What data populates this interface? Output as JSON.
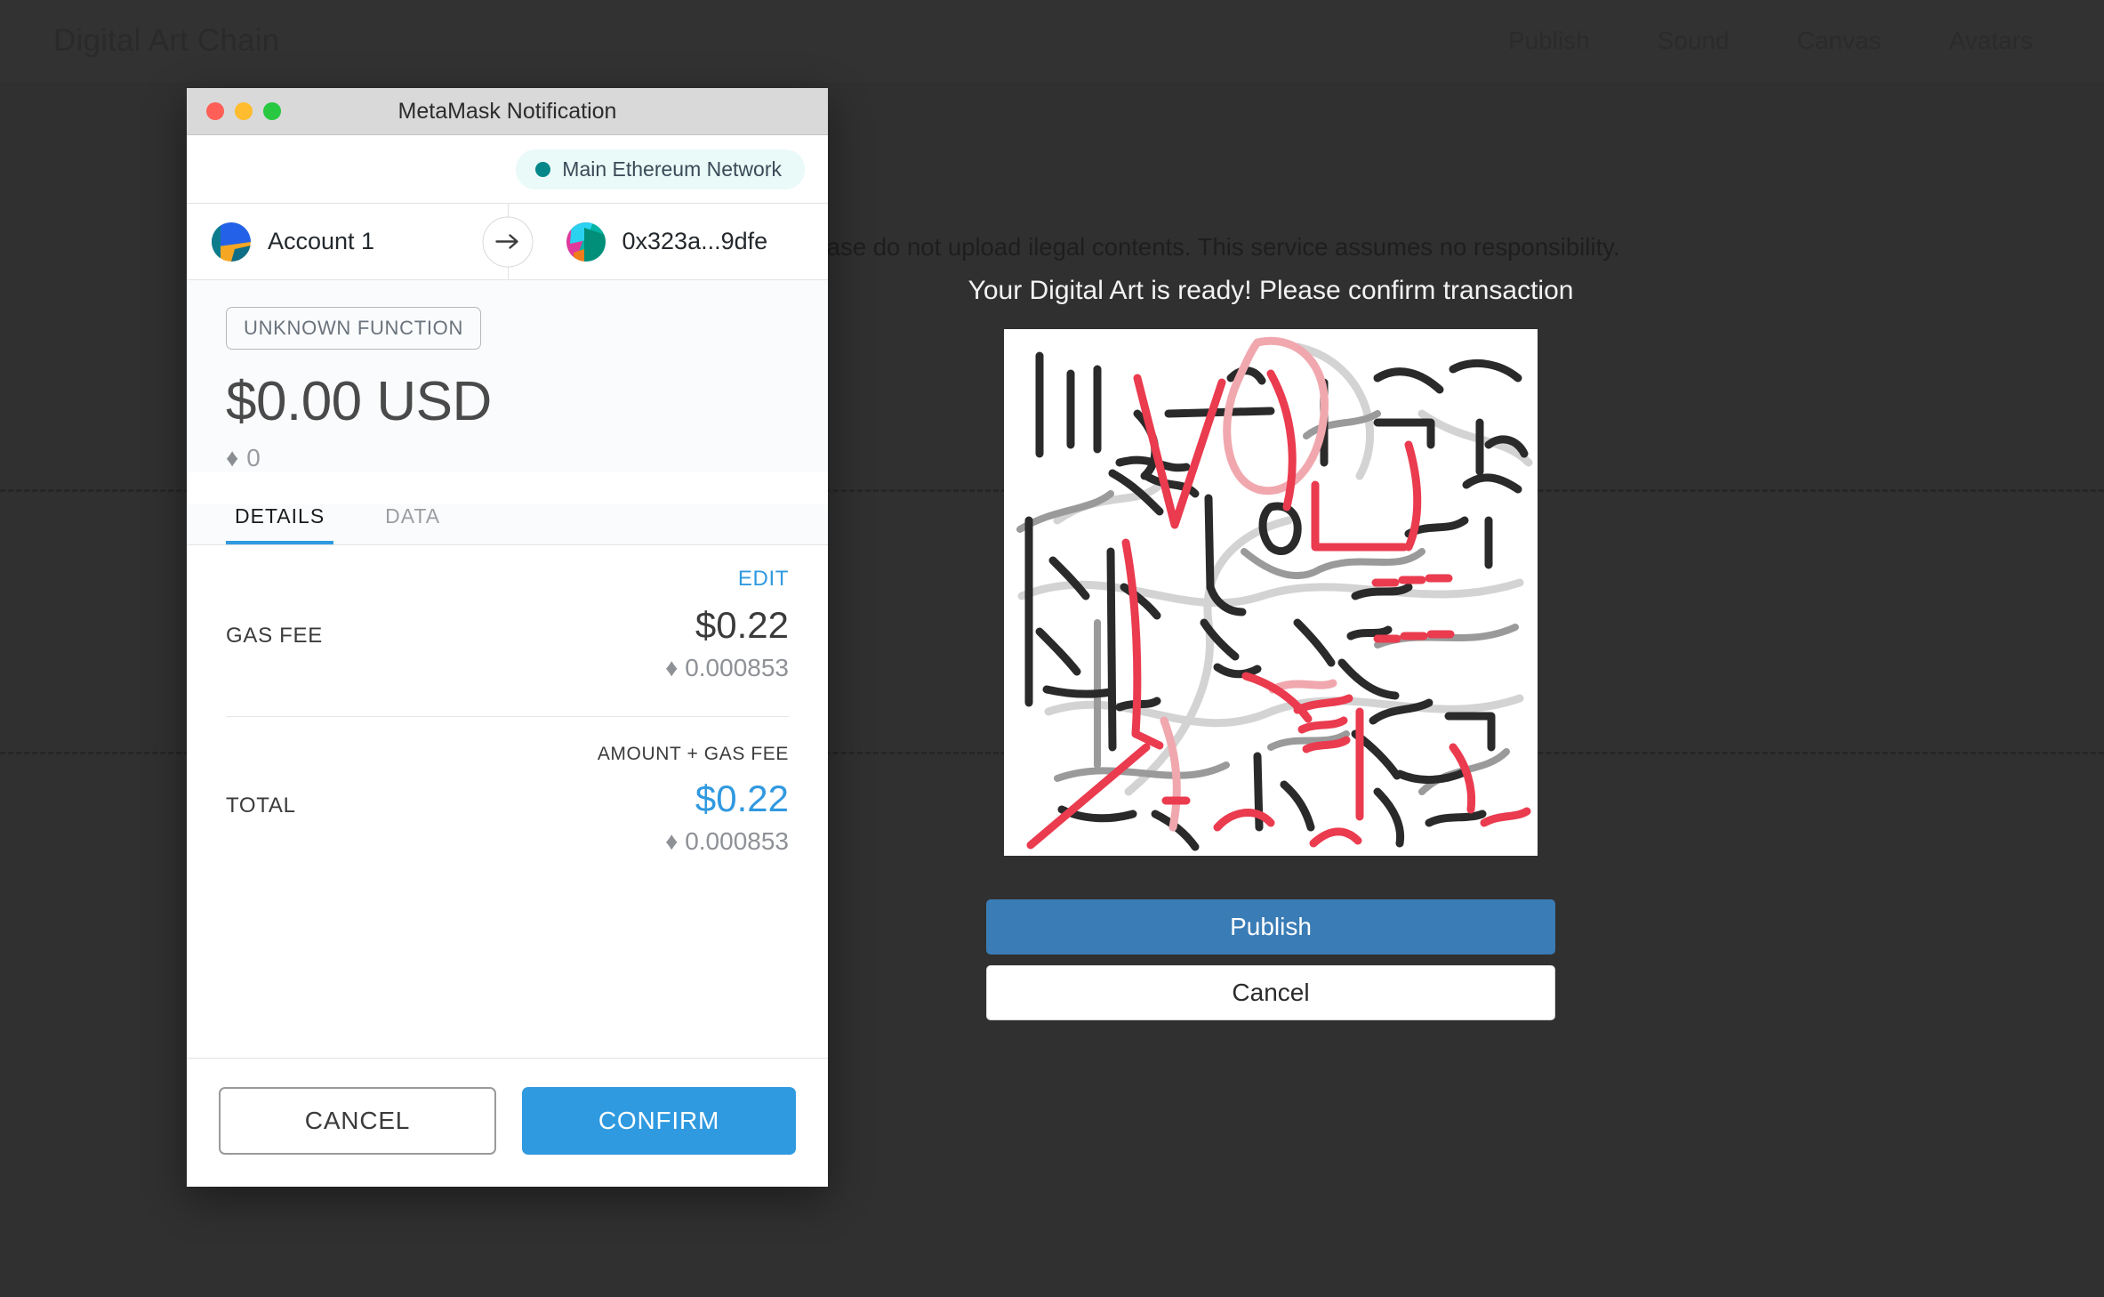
{
  "page": {
    "brand": "Digital Art Chain",
    "nav": [
      {
        "label": "Publish"
      },
      {
        "label": "Sound"
      },
      {
        "label": "Canvas"
      },
      {
        "label": "Avatars"
      }
    ],
    "warning_text": "cannot be deleted/modified. Please do not upload ilegal contents. This service assumes no responsibility.",
    "confirm_heading": "Your Digital Art is ready! Please confirm transaction",
    "publish_button": "Publish",
    "cancel_button": "Cancel",
    "colors": {
      "background": "#303030",
      "header": "#323232",
      "publish_blue": "#3a7cb5",
      "dashed_rule": "#262626"
    }
  },
  "metamask": {
    "window_title": "MetaMask Notification",
    "traffic_lights": {
      "close": "close-button",
      "minimize": "minimize-button",
      "zoom": "zoom-button"
    },
    "network": {
      "label": "Main Ethereum Network",
      "dot_color": "#038789",
      "pill_color": "#eafaf8"
    },
    "accounts": {
      "from": "Account 1",
      "to": "0x323a...9dfe",
      "arrow_icon": "arrow-right-icon"
    },
    "function_badge": "UNKNOWN FUNCTION",
    "amount": {
      "usd": "$0.00 USD",
      "eth_glyph": "♦",
      "eth": "0"
    },
    "tabs": [
      {
        "label": "DETAILS",
        "active": true
      },
      {
        "label": "DATA",
        "active": false
      }
    ],
    "details": {
      "edit_link": "EDIT",
      "gas_fee": {
        "label": "GAS FEE",
        "usd": "$0.22",
        "eth_glyph": "♦",
        "eth": "0.000853"
      },
      "total": {
        "label": "TOTAL",
        "sublabel": "AMOUNT + GAS FEE",
        "usd": "$0.22",
        "eth_glyph": "♦",
        "eth": "0.000853",
        "usd_color": "#3099e0"
      }
    },
    "footer": {
      "cancel_label": "CANCEL",
      "confirm_label": "CONFIRM",
      "confirm_color": "#2f9ae0"
    }
  },
  "artwork": {
    "description": "Generative abstract line drawing of black, gray and red brush strokes on white canvas",
    "stroke_colors": [
      "#1f1f1f",
      "#4d4d4d",
      "#8c8c8c",
      "#cfcfcf",
      "#e8384f",
      "#ef5a6a",
      "#f0a8ae"
    ]
  }
}
